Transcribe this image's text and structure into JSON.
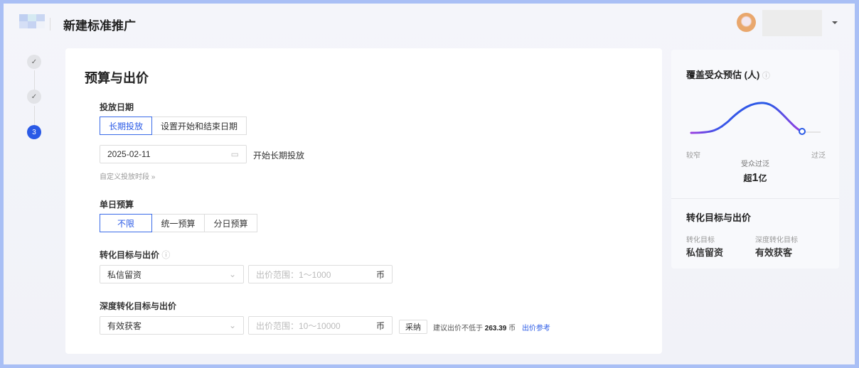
{
  "header": {
    "title": "新建标准推广"
  },
  "steps": [
    {
      "icon": "check"
    },
    {
      "icon": "check"
    },
    {
      "label": "3"
    }
  ],
  "main": {
    "title": "预算与出价",
    "date": {
      "label": "投放日期",
      "options": [
        "长期投放",
        "设置开始和结束日期"
      ],
      "value": "2025-02-11",
      "suffix": "开始长期投放",
      "custom": "自定义投放时段"
    },
    "budget": {
      "label": "单日预算",
      "options": [
        "不限",
        "统一预算",
        "分日预算"
      ]
    },
    "conv": {
      "label": "转化目标与出价",
      "select": "私信留资",
      "placeholder": "出价范围：1～1000",
      "unit": "币"
    },
    "deep": {
      "label": "深度转化目标与出价",
      "select": "有效获客",
      "placeholder": "出价范围：10～10000",
      "unit": "币",
      "adopt": "采纳",
      "suggest_prefix": "建议出价不低于",
      "suggest_value": "263.39",
      "suggest_unit": "币",
      "ref_link": "出价参考"
    }
  },
  "side": {
    "title": "覆盖受众预估 (人)",
    "left": "较窄",
    "right": "过泛",
    "status": "受众过泛",
    "prefix": "超",
    "number": "1",
    "suffix": "亿",
    "conv_title": "转化目标与出价",
    "conv_label": "转化目标",
    "conv_value": "私信留资",
    "deep_label": "深度转化目标",
    "deep_value": "有效获客"
  }
}
